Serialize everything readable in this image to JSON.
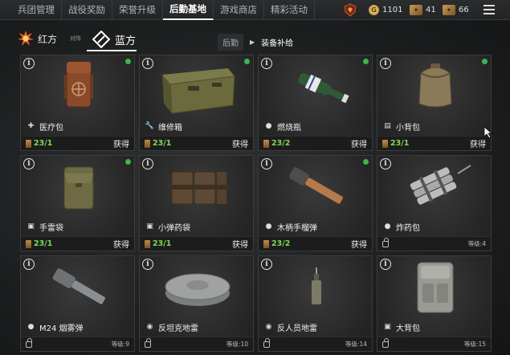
{
  "topbar": {
    "tabs": [
      "兵团管理",
      "战役奖励",
      "荣誉升级",
      "后勤基地",
      "游戏商店",
      "精彩活动"
    ],
    "active_tab": 3,
    "currency": [
      {
        "icon": "gold-coin-icon",
        "value": "1101"
      },
      {
        "icon": "card-icon",
        "value": "41"
      },
      {
        "icon": "card-stack-icon",
        "value": "66"
      }
    ]
  },
  "factions": {
    "red": "红方",
    "vs": "对阵",
    "blue": "蓝方"
  },
  "breadcrumb": {
    "parent": "后勤",
    "current": "装备补给"
  },
  "items": [
    {
      "name": "医疗包",
      "progress": "23/1",
      "action": "获得",
      "new": true,
      "locked": false,
      "icon": "medical-kit-icon"
    },
    {
      "name": "维修箱",
      "progress": "23/1",
      "action": "获得",
      "new": true,
      "locked": false,
      "icon": "wrench-icon"
    },
    {
      "name": "燃烧瓶",
      "progress": "23/2",
      "action": "获得",
      "new": true,
      "locked": false,
      "icon": "grenade-icon"
    },
    {
      "name": "小背包",
      "progress": "23/1",
      "action": "获得",
      "new": true,
      "locked": false,
      "icon": "backpack-icon"
    },
    {
      "name": "手雷袋",
      "progress": "23/1",
      "action": "获得",
      "new": true,
      "locked": false,
      "icon": "pouch-icon"
    },
    {
      "name": "小弹药袋",
      "progress": "23/1",
      "action": "获得",
      "new": true,
      "locked": false,
      "icon": "pouch-icon"
    },
    {
      "name": "木柄手榴弹",
      "progress": "23/2",
      "action": "获得",
      "new": true,
      "locked": false,
      "icon": "grenade-icon"
    },
    {
      "name": "炸药包",
      "level": "等级:4",
      "locked": true,
      "new": false,
      "icon": "grenade-icon"
    },
    {
      "name": "M24 烟雾弹",
      "level": "等级:9",
      "locked": true,
      "new": false,
      "icon": "grenade-icon"
    },
    {
      "name": "反坦克地雷",
      "level": "等级:10",
      "locked": true,
      "new": false,
      "icon": "mine-icon"
    },
    {
      "name": "反人员地雷",
      "level": "等级:14",
      "locked": true,
      "new": false,
      "icon": "mine-icon"
    },
    {
      "name": "大背包",
      "level": "等级:15",
      "locked": true,
      "new": false,
      "icon": "pouch-icon"
    }
  ],
  "colors": {
    "progress": "#7ed957",
    "new_badge": "#3fb34f",
    "accent_active": "#ffffff"
  }
}
